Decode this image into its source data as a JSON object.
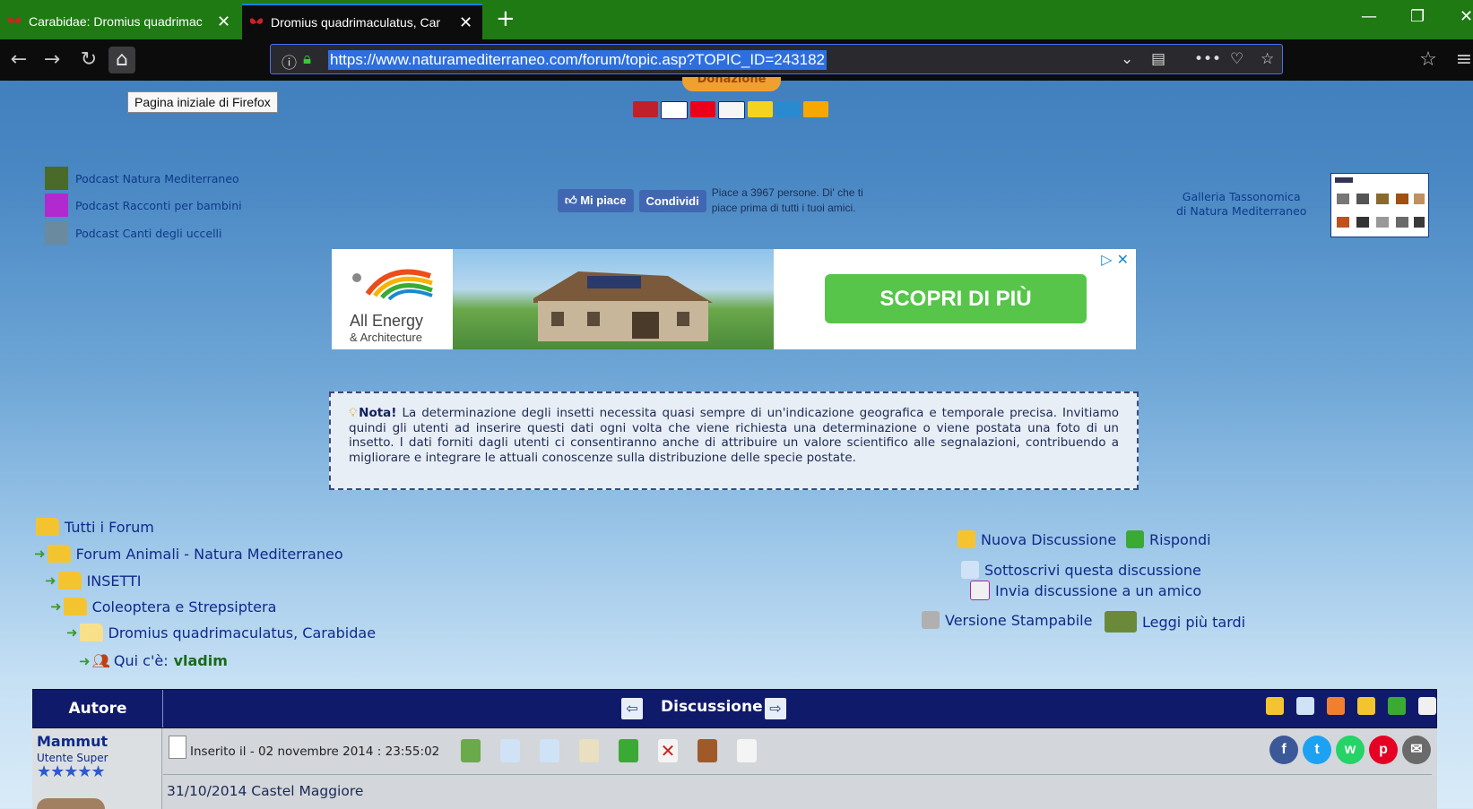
{
  "browser": {
    "tabs": [
      {
        "title": "Carabidae: Dromius quadrimac",
        "active": false
      },
      {
        "title": "Dromius quadrimaculatus, Car",
        "active": true
      }
    ],
    "url": "https://www.naturamediterraneo.com/forum/topic.asp?TOPIC_ID=243182",
    "tooltip": "Pagina iniziale di Firefox",
    "colors": {
      "tabbar": "#1f7a14",
      "toolbar": "#0c0c0d",
      "url_highlight": "#2d6fe0"
    }
  },
  "header": {
    "donazione_label": "Donazione"
  },
  "podcasts": [
    {
      "label": "Podcast Natura Mediterraneo"
    },
    {
      "label": "Podcast Racconti per bambini"
    },
    {
      "label": "Podcast Canti degli uccelli"
    }
  ],
  "facebook": {
    "like_label": "Mi piace",
    "share_label": "Condividi",
    "text": "Piace a 3967 persone. Di' che ti piace prima di tutti i tuoi amici."
  },
  "galleria": {
    "line1": "Galleria Tassonomica",
    "line2": "di Natura Mediterraneo"
  },
  "ad": {
    "brand_line1": "All Energy",
    "brand_line2": "& Architecture",
    "cta": "SCOPRI DI PIÙ",
    "close": "▷ ✕"
  },
  "note": {
    "label": "Nota!",
    "text": "La determinazione degli insetti necessita quasi sempre di un'indicazione geografica e temporale precisa. Invitiamo quindi gli utenti ad inserire questi dati ogni volta che viene richiesta una determinazione o viene postata una foto di un insetto. I dati forniti dagli utenti ci consentiranno anche di attribuire un valore scientifico alle segnalazioni, contribuendo a migliorare e integrare le attuali conoscenze sulla distribuzione delle specie postate."
  },
  "breadcrumb": [
    {
      "label": "Tutti i Forum"
    },
    {
      "label": "Forum Animali - Natura Mediterraneo"
    },
    {
      "label": "INSETTI"
    },
    {
      "label": "Coleoptera e Strepsiptera"
    },
    {
      "label": "Dromius quadrimaculatus, Carabidae"
    }
  ],
  "presence": {
    "label": "Qui c'è:",
    "user": "vladim"
  },
  "actions": {
    "new_topic": "Nuova Discussione",
    "reply": "Rispondi",
    "subscribe": "Sottoscrivi questa discussione",
    "send_friend": "Invia discussione a un amico",
    "print": "Versione Stampabile",
    "read_later": "Leggi più tardi"
  },
  "table": {
    "col_author": "Autore",
    "col_topic": "Discussione"
  },
  "post": {
    "author": "Mammut",
    "rank": "Utente Super",
    "stars": "★★★★★",
    "posted": "Inserito il - 02 novembre 2014 : 23:55:02",
    "first_line": "31/10/2014 Castel Maggiore",
    "social": [
      {
        "icon": "facebook-icon",
        "glyph": "f",
        "color": "#3b5998"
      },
      {
        "icon": "twitter-icon",
        "glyph": "t",
        "color": "#1da1f2"
      },
      {
        "icon": "whatsapp-icon",
        "glyph": "w",
        "color": "#25d366"
      },
      {
        "icon": "pinterest-icon",
        "glyph": "p",
        "color": "#e60023"
      },
      {
        "icon": "email-icon",
        "glyph": "✉",
        "color": "#6a6a6a"
      }
    ]
  }
}
